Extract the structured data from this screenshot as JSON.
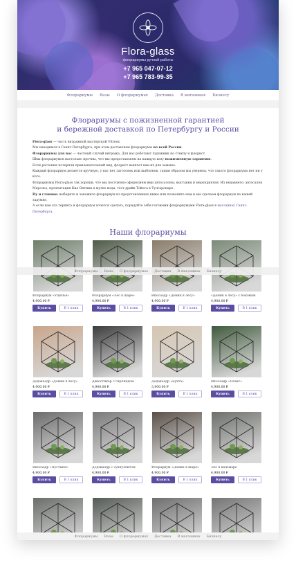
{
  "brand": {
    "title": "Flora-glass",
    "subtitle": "флорариумы ручной работы"
  },
  "phones": [
    "+7 965 047-07-12",
    "+7 965 783-99-35"
  ],
  "nav": [
    "Флорариумы",
    "Вазы",
    "О флорариумах",
    "Доставка",
    "В магазинах",
    "Бизнесу"
  ],
  "intro": {
    "title_line1": "Флорариумы с пожизненной гарантией",
    "title_line2": "и бережной доставкой по Петербургу и России",
    "p1_bold": "Flora-glass",
    "p1": " — часть витражной мастерской Vitreus.",
    "p2": "Мы находимся в Санкт-Петербурге, при этом доставляем флорариумы ",
    "p2_bold": "по всей России",
    "p2_end": ".",
    "p3_bold": "Флорариумы для вас",
    "p3": " — частный случай витража. Для вас работают художник по стеклу и флорист.",
    "p4": "Швы флорариумов настолько прочны, что мы предоставляем на каждую вазу ",
    "p4_bold": "пожизненную гарантию",
    "p4_end": ".",
    "p5": "Если растения потеряли привлекательный вид, флорист вышлет вам их для замены.",
    "p6": "Каждый флорариум делается вручную, у нас нет заготовок или шаблонов, таким образом мы уверены, что такого флорариума нет ни у кого.",
    "p7": "Флорариумы Flora-glass так хороши, что мы постоянно оформляем ими автосалоны, выставки и мероприятия. Из недавнего: автосалон Меролье, презентация Киа Оптима в музее воды, тест-драйв Тойота в Тулгаронаре.",
    "p8_bold": "Ну и главное:",
    "p8": " выберите и закажите флорариум из представленных ниже или позвоните нам и мы сделаем флорариум по вашей задумке.",
    "p9": "А если вам эта терпита и флорариум хочется сделать, порадуйте себя готовыми флорариумами Flora-glass в ",
    "p9_link": "магазинах Санкт-Петербурга",
    "p9_end": "."
  },
  "catalog_title": "Наши флорариумы",
  "buttons": {
    "buy": "Купить",
    "one_click": "В 1 клик"
  },
  "products": [
    {
      "name": "Флорариум «Ущелье»",
      "price": "4,900.00 ₽",
      "tone": "#6f7e6a"
    },
    {
      "name": "Флорариум «Лес в шаре»",
      "price": "4,900.00 ₽",
      "tone": "#4e5a48"
    },
    {
      "name": "Икосаэдр «Домик в лесу»",
      "price": "4,900.00 ₽",
      "tone": "#8a7c6a"
    },
    {
      "name": "«Домик в лесу» с боковым",
      "price": "4,900.00 ₽",
      "tone": "#7c8a78"
    },
    {
      "name": "Додэкаэдр «Домик в лесу»",
      "price": "4,900.00 ₽",
      "tone": "#c9a58a"
    },
    {
      "name": "Джюстикар с гирляндом",
      "price": "4,900.00 ₽",
      "tone": "#3c3c3c"
    },
    {
      "name": "Додэкаэдр «Бухта»",
      "price": "3,900.00 ₽",
      "tone": "#d6c5b0"
    },
    {
      "name": "Икосаэдр «Оазис»",
      "price": "4,900.00 ₽",
      "tone": "#3f5a3c"
    },
    {
      "name": "Икосаэдр «Пустыня»",
      "price": "4,900.00 ₽",
      "tone": "#6b6b6b"
    },
    {
      "name": "Додэкаэдр с суккулентом",
      "price": "4,900.00 ₽",
      "tone": "#7a7a7a"
    },
    {
      "name": "Флорариум «Домик в шаре»",
      "price": "4,900.00 ₽",
      "tone": "#5a5048"
    },
    {
      "name": "Лес в кальмаре",
      "price": "4,900.00 ₽",
      "tone": "#6c6f6a"
    },
    {
      "name": "",
      "price": "",
      "tone": "#6a6d6a"
    },
    {
      "name": "",
      "price": "",
      "tone": "#555a55"
    },
    {
      "name": "",
      "price": "",
      "tone": "#6e6e6e"
    },
    {
      "name": "",
      "price": "",
      "tone": "#747474"
    }
  ]
}
